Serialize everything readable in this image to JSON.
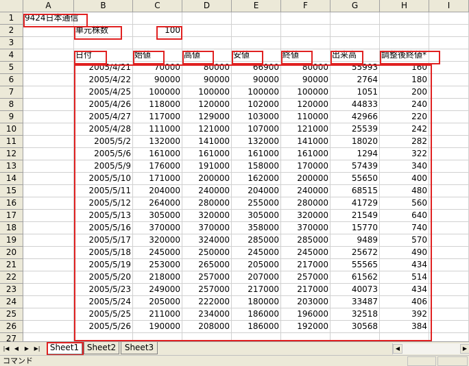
{
  "columns": [
    "A",
    "B",
    "C",
    "D",
    "E",
    "F",
    "G",
    "H",
    "I"
  ],
  "rows": [
    [
      "9424日本通信",
      "",
      "",
      "",
      "",
      "",
      "",
      "",
      ""
    ],
    [
      "",
      "単元株数",
      "100",
      "",
      "",
      "",
      "",
      "",
      ""
    ],
    [
      "",
      "",
      "",
      "",
      "",
      "",
      "",
      "",
      ""
    ],
    [
      "",
      "日付",
      "始値",
      "高値",
      "安値",
      "終値",
      "出来高",
      "調整後終値*",
      ""
    ],
    [
      "",
      "2005/4/21",
      "70000",
      "80000",
      "66900",
      "80000",
      "55993",
      "160",
      ""
    ],
    [
      "",
      "2005/4/22",
      "90000",
      "90000",
      "90000",
      "90000",
      "2764",
      "180",
      ""
    ],
    [
      "",
      "2005/4/25",
      "100000",
      "100000",
      "100000",
      "100000",
      "1051",
      "200",
      ""
    ],
    [
      "",
      "2005/4/26",
      "118000",
      "120000",
      "102000",
      "120000",
      "44833",
      "240",
      ""
    ],
    [
      "",
      "2005/4/27",
      "117000",
      "129000",
      "103000",
      "110000",
      "42966",
      "220",
      ""
    ],
    [
      "",
      "2005/4/28",
      "111000",
      "121000",
      "107000",
      "121000",
      "25539",
      "242",
      ""
    ],
    [
      "",
      "2005/5/2",
      "132000",
      "141000",
      "132000",
      "141000",
      "18020",
      "282",
      ""
    ],
    [
      "",
      "2005/5/6",
      "161000",
      "161000",
      "161000",
      "161000",
      "1294",
      "322",
      ""
    ],
    [
      "",
      "2005/5/9",
      "176000",
      "191000",
      "158000",
      "170000",
      "57439",
      "340",
      ""
    ],
    [
      "",
      "2005/5/10",
      "171000",
      "200000",
      "162000",
      "200000",
      "55650",
      "400",
      ""
    ],
    [
      "",
      "2005/5/11",
      "204000",
      "240000",
      "204000",
      "240000",
      "68515",
      "480",
      ""
    ],
    [
      "",
      "2005/5/12",
      "264000",
      "280000",
      "255000",
      "280000",
      "41729",
      "560",
      ""
    ],
    [
      "",
      "2005/5/13",
      "305000",
      "320000",
      "305000",
      "320000",
      "21549",
      "640",
      ""
    ],
    [
      "",
      "2005/5/16",
      "370000",
      "370000",
      "358000",
      "370000",
      "15770",
      "740",
      ""
    ],
    [
      "",
      "2005/5/17",
      "320000",
      "324000",
      "285000",
      "285000",
      "9489",
      "570",
      ""
    ],
    [
      "",
      "2005/5/18",
      "245000",
      "250000",
      "245000",
      "245000",
      "25672",
      "490",
      ""
    ],
    [
      "",
      "2005/5/19",
      "253000",
      "265000",
      "205000",
      "217000",
      "55565",
      "434",
      ""
    ],
    [
      "",
      "2005/5/20",
      "218000",
      "257000",
      "207000",
      "257000",
      "61562",
      "514",
      ""
    ],
    [
      "",
      "2005/5/23",
      "249000",
      "257000",
      "217000",
      "217000",
      "40073",
      "434",
      ""
    ],
    [
      "",
      "2005/5/24",
      "205000",
      "222000",
      "180000",
      "203000",
      "33487",
      "406",
      ""
    ],
    [
      "",
      "2005/5/25",
      "211000",
      "234000",
      "186000",
      "196000",
      "32518",
      "392",
      ""
    ],
    [
      "",
      "2005/5/26",
      "190000",
      "208000",
      "186000",
      "192000",
      "30568",
      "384",
      ""
    ]
  ],
  "tabs": [
    "Sheet1",
    "Sheet2",
    "Sheet3"
  ],
  "status": "コマンド"
}
